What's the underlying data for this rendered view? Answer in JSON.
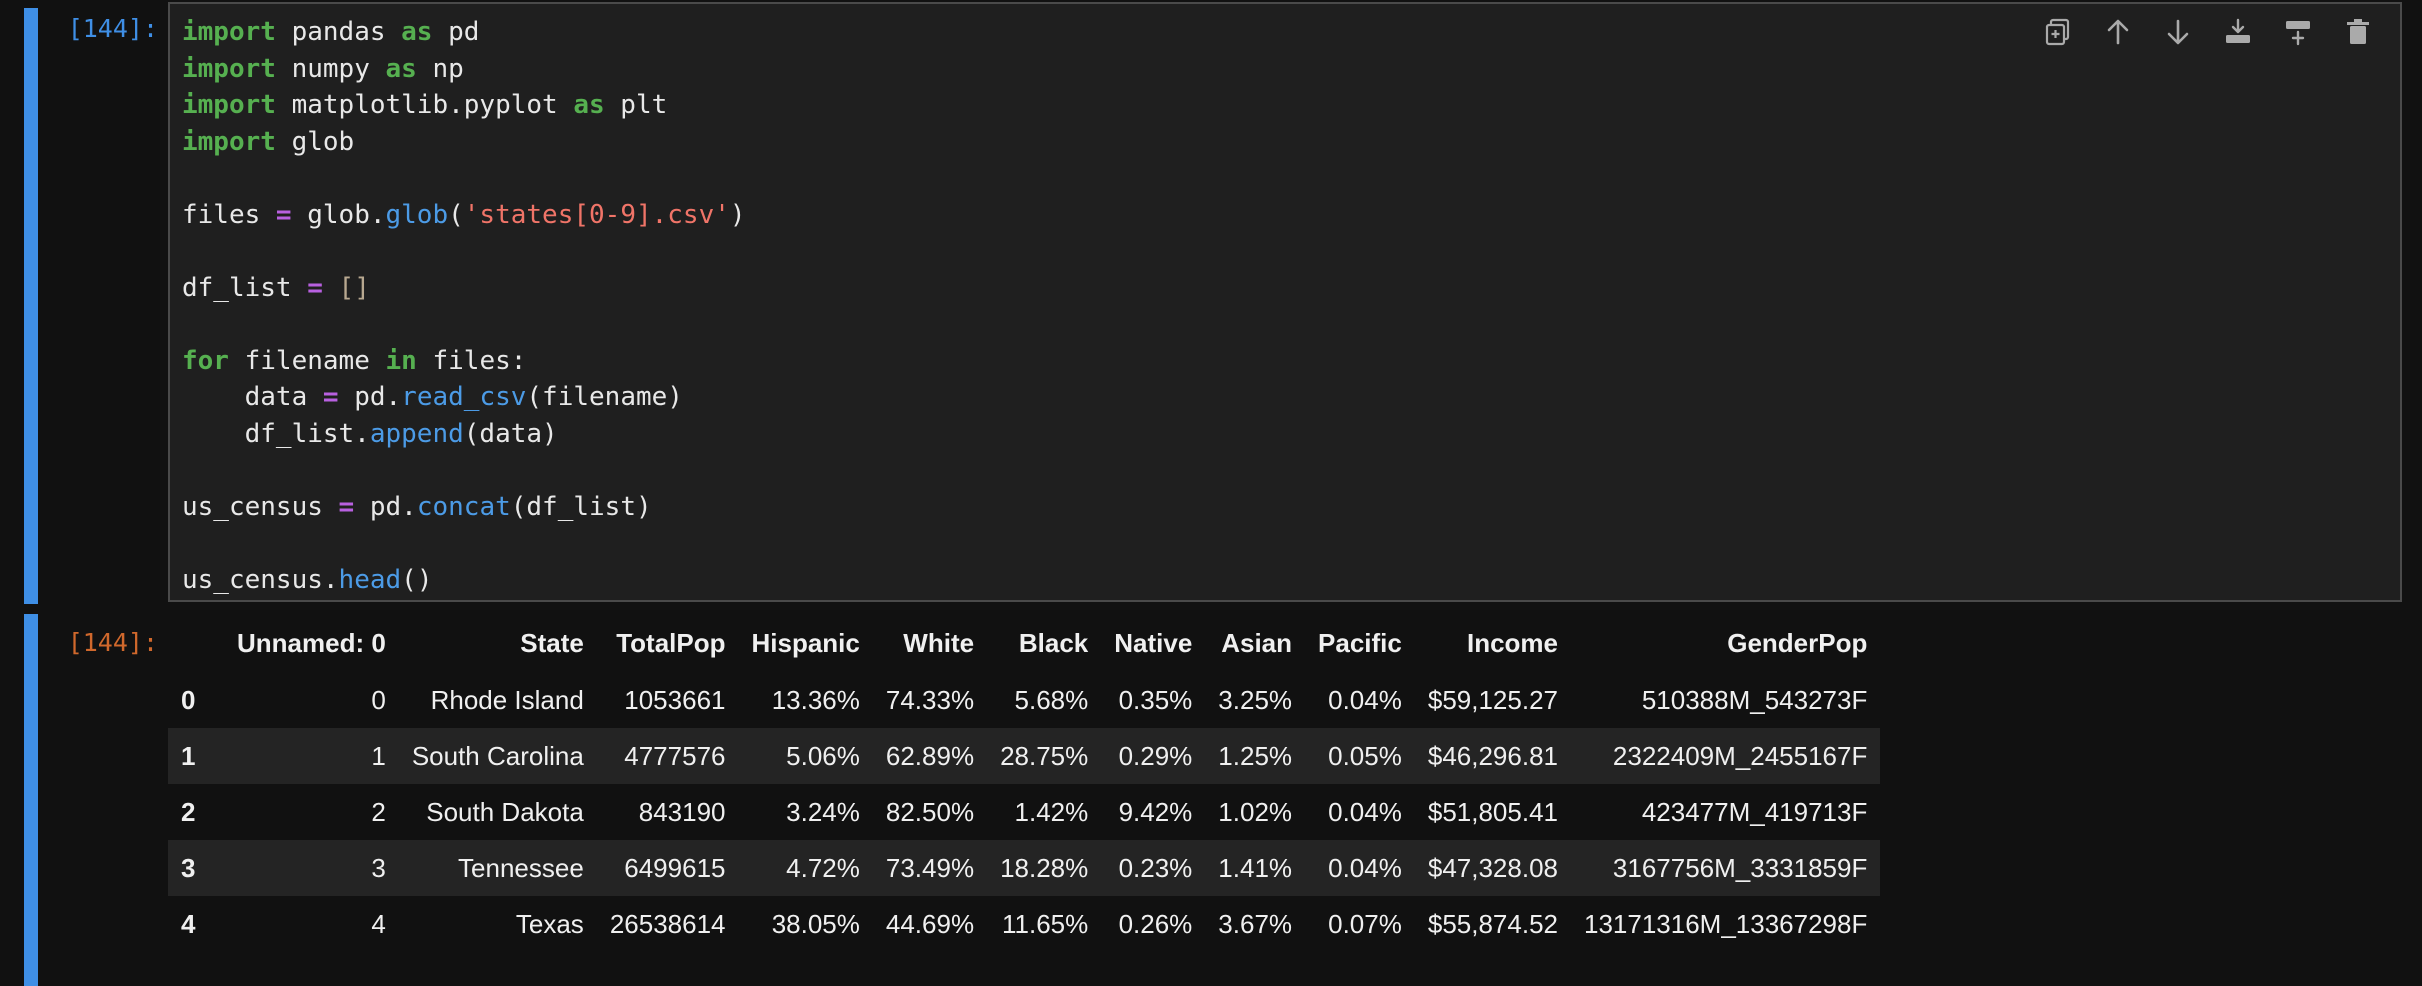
{
  "input_cell": {
    "prompt": "[144]:",
    "code_lines": [
      [
        {
          "t": "import",
          "c": "kw"
        },
        {
          "t": " pandas "
        },
        {
          "t": "as",
          "c": "kw"
        },
        {
          "t": " pd"
        }
      ],
      [
        {
          "t": "import",
          "c": "kw"
        },
        {
          "t": " numpy "
        },
        {
          "t": "as",
          "c": "kw"
        },
        {
          "t": " np"
        }
      ],
      [
        {
          "t": "import",
          "c": "kw"
        },
        {
          "t": " matplotlib.pyplot "
        },
        {
          "t": "as",
          "c": "kw"
        },
        {
          "t": " plt"
        }
      ],
      [
        {
          "t": "import",
          "c": "kw"
        },
        {
          "t": " glob"
        }
      ],
      [],
      [
        {
          "t": "files "
        },
        {
          "t": "=",
          "c": "op"
        },
        {
          "t": " glob."
        },
        {
          "t": "glob",
          "c": "fn"
        },
        {
          "t": "("
        },
        {
          "t": "'states[0-9].csv'",
          "c": "st"
        },
        {
          "t": ")"
        }
      ],
      [],
      [
        {
          "t": "df_list "
        },
        {
          "t": "=",
          "c": "op"
        },
        {
          "t": " "
        },
        {
          "t": "[]",
          "c": "br"
        }
      ],
      [],
      [
        {
          "t": "for",
          "c": "kw"
        },
        {
          "t": " filename "
        },
        {
          "t": "in",
          "c": "kw"
        },
        {
          "t": " files:"
        }
      ],
      [
        {
          "t": "    data "
        },
        {
          "t": "=",
          "c": "op"
        },
        {
          "t": " pd."
        },
        {
          "t": "read_csv",
          "c": "fn"
        },
        {
          "t": "(filename)"
        }
      ],
      [
        {
          "t": "    df_list."
        },
        {
          "t": "append",
          "c": "fn"
        },
        {
          "t": "(data)"
        }
      ],
      [],
      [
        {
          "t": "us_census "
        },
        {
          "t": "=",
          "c": "op"
        },
        {
          "t": " pd."
        },
        {
          "t": "concat",
          "c": "fn"
        },
        {
          "t": "(df_list)"
        }
      ],
      [],
      [
        {
          "t": "us_census."
        },
        {
          "t": "head",
          "c": "fn"
        },
        {
          "t": "()"
        }
      ]
    ],
    "toolbar": [
      {
        "name": "duplicate-cell-button",
        "icon": "duplicate-icon"
      },
      {
        "name": "move-up-button",
        "icon": "arrow-up-icon"
      },
      {
        "name": "move-down-button",
        "icon": "arrow-down-icon"
      },
      {
        "name": "insert-above-button",
        "icon": "insert-above-icon"
      },
      {
        "name": "insert-below-button",
        "icon": "insert-below-icon"
      },
      {
        "name": "delete-cell-button",
        "icon": "trash-icon"
      }
    ]
  },
  "output_cell": {
    "prompt": "[144]:",
    "table": {
      "columns": [
        "Unnamed: 0",
        "State",
        "TotalPop",
        "Hispanic",
        "White",
        "Black",
        "Native",
        "Asian",
        "Pacific",
        "Income",
        "GenderPop"
      ],
      "rows": [
        {
          "index": "0",
          "cells": [
            "0",
            "Rhode Island",
            "1053661",
            "13.36%",
            "74.33%",
            "5.68%",
            "0.35%",
            "3.25%",
            "0.04%",
            "$59,125.27",
            "510388M_543273F"
          ]
        },
        {
          "index": "1",
          "cells": [
            "1",
            "South Carolina",
            "4777576",
            "5.06%",
            "62.89%",
            "28.75%",
            "0.29%",
            "1.25%",
            "0.05%",
            "$46,296.81",
            "2322409M_2455167F"
          ]
        },
        {
          "index": "2",
          "cells": [
            "2",
            "South Dakota",
            "843190",
            "3.24%",
            "82.50%",
            "1.42%",
            "9.42%",
            "1.02%",
            "0.04%",
            "$51,805.41",
            "423477M_419713F"
          ]
        },
        {
          "index": "3",
          "cells": [
            "3",
            "Tennessee",
            "6499615",
            "4.72%",
            "73.49%",
            "18.28%",
            "0.23%",
            "1.41%",
            "0.04%",
            "$47,328.08",
            "3167756M_3331859F"
          ]
        },
        {
          "index": "4",
          "cells": [
            "4",
            "Texas",
            "26538614",
            "38.05%",
            "44.69%",
            "11.65%",
            "0.26%",
            "3.67%",
            "0.07%",
            "$55,874.52",
            "13171316M_13367298F"
          ]
        }
      ]
    }
  },
  "colors": {
    "accent": "#3f8fe6",
    "out_prompt": "#d0682c",
    "keyword": "#56b050",
    "operator": "#b860e0",
    "function": "#4c9be6",
    "string": "#f07468"
  }
}
